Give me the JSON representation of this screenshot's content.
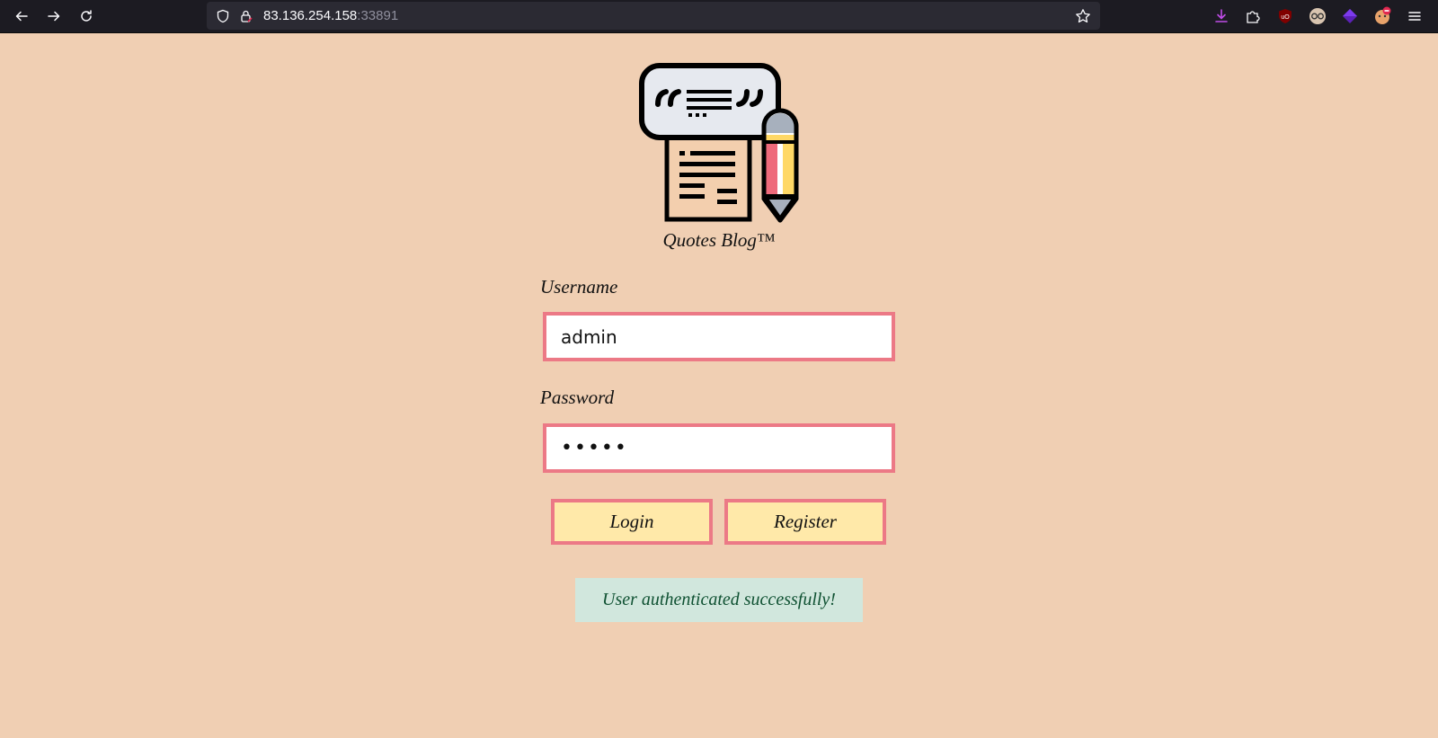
{
  "browser": {
    "url_host": "83.136.254.158",
    "url_port": ":33891"
  },
  "icons": {
    "back": "back-arrow-icon",
    "forward": "forward-arrow-icon",
    "reload": "reload-icon",
    "shield": "shield-icon",
    "lock": "lock-icon",
    "bookmark": "star-icon",
    "downloads": "download-icon",
    "extensions": "puzzle-icon",
    "ublock": "ublock-icon",
    "menu": "hamburger-icon"
  },
  "brand": {
    "name": "Quotes Blog™"
  },
  "form": {
    "username_label": "Username",
    "username_value": "admin",
    "password_label": "Password",
    "password_value": "•••••",
    "login_label": "Login",
    "register_label": "Register"
  },
  "alert": {
    "message": "User authenticated successfully!"
  },
  "colors": {
    "page_bg": "#f0cfb3",
    "input_border": "#ec7986",
    "button_bg": "#ffe9a9",
    "alert_bg": "#d1e7dd",
    "alert_text": "#0f5132"
  }
}
